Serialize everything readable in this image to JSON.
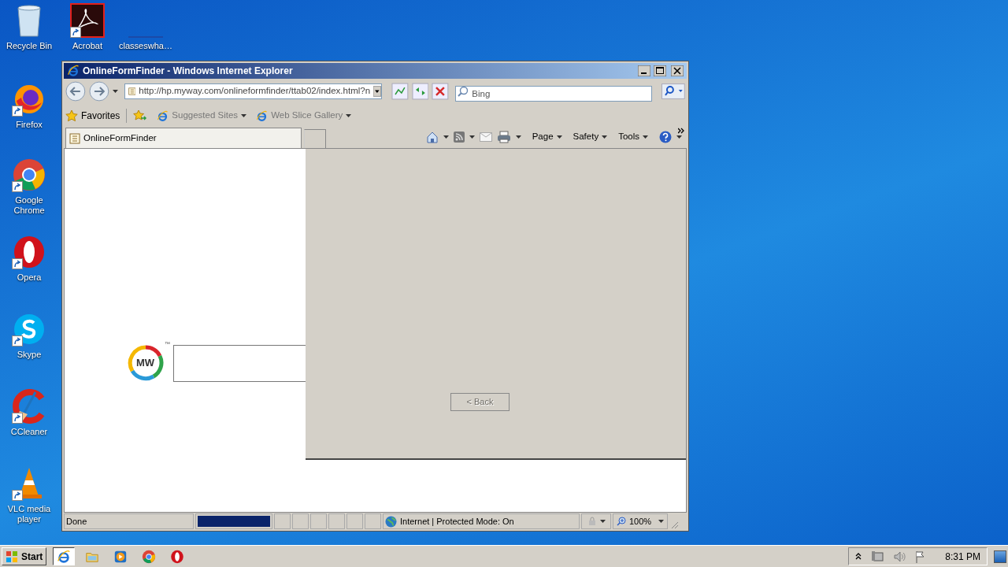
{
  "desktop_icons": [
    {
      "kind": "recycle",
      "label": "Recycle Bin"
    },
    {
      "kind": "acrobat",
      "label": "Acrobat"
    },
    {
      "kind": "blank",
      "label": "classeswha…"
    },
    {
      "kind": "firefox",
      "label": "Firefox"
    },
    {
      "kind": "chrome",
      "label": "Google Chrome"
    },
    {
      "kind": "opera",
      "label": "Opera"
    },
    {
      "kind": "skype",
      "label": "Skype"
    },
    {
      "kind": "ccleaner",
      "label": "CCleaner"
    },
    {
      "kind": "vlc",
      "label": "VLC media player"
    }
  ],
  "window": {
    "title": "OnlineFormFinder - Windows Internet Explorer",
    "address": "http://hp.myway.com/onlineformfinder/ttab02/index.html?n",
    "search": {
      "placeholder": "Bing"
    },
    "favorites": {
      "label": "Favorites",
      "links": [
        {
          "label": "Suggested Sites"
        },
        {
          "label": "Web Slice Gallery"
        }
      ]
    },
    "tab": {
      "title": "OnlineFormFinder"
    },
    "logo": {
      "text": "MW",
      "mark": "™"
    },
    "commands": [
      {
        "label": "Page"
      },
      {
        "label": "Safety"
      },
      {
        "label": "Tools"
      }
    ],
    "dialog": {
      "back_button": {
        "label": "< Back",
        "disabled": true
      }
    },
    "status_bar": {
      "text": "Done",
      "progress": {
        "level": 1
      },
      "zone": "Internet | Protected Mode: On",
      "zoom": "100%"
    }
  },
  "taskbar": {
    "start": "Start",
    "apps": [
      {
        "kind": "ie",
        "selected": true
      },
      {
        "kind": "folder",
        "selected": false
      },
      {
        "kind": "media",
        "selected": false
      },
      {
        "kind": "chrome",
        "selected": false
      },
      {
        "kind": "opera",
        "selected": false
      }
    ],
    "clock": "8:31 PM"
  }
}
